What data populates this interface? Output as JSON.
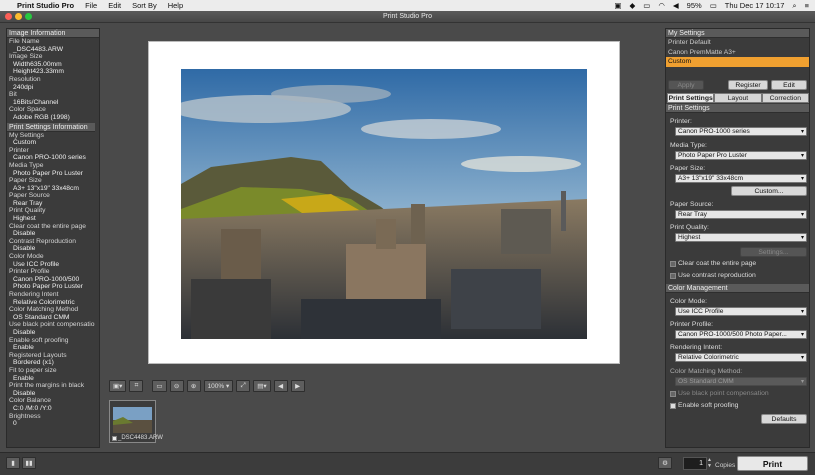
{
  "menubar": {
    "app_name": "Print Studio Pro",
    "items": [
      "File",
      "Edit",
      "Sort By",
      "Help"
    ],
    "battery": "95%",
    "datetime": "Thu Dec 17  10:17"
  },
  "window": {
    "title": "Print Studio Pro"
  },
  "left_panel": {
    "image_info_header": "Image Information",
    "image_info": [
      {
        "label": "File Name",
        "value": "_DSC4483.ARW"
      },
      {
        "label": "Image Size",
        "value": "Width635.00mm"
      },
      {
        "label": "",
        "value": "Height423.33mm"
      },
      {
        "label": "Resolution",
        "value": "240dpi"
      },
      {
        "label": "Bit",
        "value": "16Bits/Channel"
      },
      {
        "label": "Color Space",
        "value": "Adobe RGB (1998)"
      }
    ],
    "print_info_header": "Print Settings Information",
    "print_info": [
      {
        "label": "My Settings",
        "value": "Custom"
      },
      {
        "label": "Printer",
        "value": "Canon PRO-1000 series"
      },
      {
        "label": "Media Type",
        "value": "Photo Paper Pro Luster"
      },
      {
        "label": "Paper Size",
        "value": "A3+ 13\"x19\" 33x48cm"
      },
      {
        "label": "Paper Source",
        "value": "Rear Tray"
      },
      {
        "label": "Print Quality",
        "value": "Highest"
      },
      {
        "label": "Clear coat the entire page",
        "value": "Disable"
      },
      {
        "label": "Contrast Reproduction",
        "value": "Disable"
      },
      {
        "label": "Color Mode",
        "value": "Use ICC Profile"
      },
      {
        "label": "Printer Profile",
        "value": "Canon PRO-1000/500"
      },
      {
        "label": "",
        "value": "Photo Paper Pro Luster"
      },
      {
        "label": "Rendering Intent",
        "value": "Relative Colorimetric"
      },
      {
        "label": "Color Matching Method",
        "value": "OS Standard CMM"
      },
      {
        "label": "Use black point compensation",
        "value": "Disable"
      },
      {
        "label": "Enable soft proofing",
        "value": "Enable"
      },
      {
        "label": "Registered Layouts",
        "value": "Bordered (x1)"
      },
      {
        "label": "Fit to paper size",
        "value": "Enable"
      },
      {
        "label": "Print the margins in black",
        "value": "Disable"
      },
      {
        "label": "Color Balance",
        "value": "C:0 /M:0 /Y:0"
      },
      {
        "label": "Brightness",
        "value": "0"
      }
    ]
  },
  "toolbar": {
    "zoom": "100%"
  },
  "thumbnail": {
    "filename": "_DSC4483.ARW"
  },
  "right_panel": {
    "my_settings_header": "My Settings",
    "my_settings_items": [
      "Printer Default",
      "Canon PremMatte A3+",
      "Custom"
    ],
    "apply": "Apply",
    "register": "Register",
    "edit": "Edit",
    "tabs": [
      "Print Settings",
      "Layout",
      "Correction"
    ],
    "print_settings_header": "Print Settings",
    "printer_label": "Printer:",
    "printer_value": "Canon PRO-1000 series",
    "media_label": "Media Type:",
    "media_value": "Photo Paper Pro Luster",
    "paper_size_label": "Paper Size:",
    "paper_size_value": "A3+ 13\"x19\" 33x48cm",
    "custom_button": "Custom...",
    "paper_source_label": "Paper Source:",
    "paper_source_value": "Rear Tray",
    "quality_label": "Print Quality:",
    "quality_value": "Highest",
    "settings_button": "Settings...",
    "clear_coat": "Clear coat the entire page",
    "contrast": "Use contrast reproduction",
    "color_mgmt_header": "Color Management",
    "color_mode_label": "Color Mode:",
    "color_mode_value": "Use ICC Profile",
    "profile_label": "Printer Profile:",
    "profile_value": "Canon PRO-1000/500 Photo Paper...",
    "intent_label": "Rendering Intent:",
    "intent_value": "Relative Colorimetric",
    "cmm_label": "Color Matching Method:",
    "cmm_value": "OS Standard CMM",
    "black_point": "Use black point compensation",
    "soft_proof": "Enable soft proofing",
    "defaults_button": "Defaults"
  },
  "bottom": {
    "copies_value": "1",
    "copies_label": "Copies",
    "print_button": "Print"
  }
}
